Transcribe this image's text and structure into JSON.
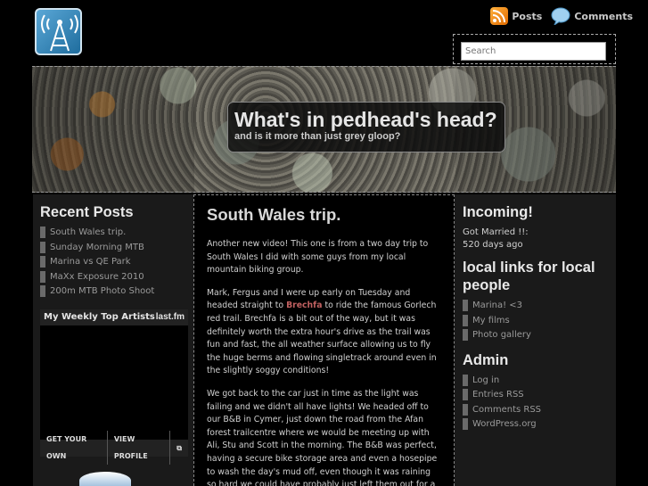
{
  "header": {
    "posts_label": "Posts",
    "comments_label": "Comments",
    "search_placeholder": "Search"
  },
  "banner": {
    "title": "What's in pedhead's head?",
    "subtitle": "and is it more than just grey gloop?"
  },
  "left": {
    "recent_title": "Recent Posts",
    "recent_posts": [
      "South Wales trip.",
      "Sunday Morning MTB",
      "Marina vs QE Park",
      "MaXx Exposure 2010",
      "200m MTB Photo Shoot"
    ],
    "lastfm_title": "My Weekly Top Artists",
    "lastfm_logo": "last.fm",
    "lastfm_get": "GET YOUR OWN",
    "lastfm_view": "VIEW PROFILE"
  },
  "post": {
    "title": "South Wales trip.",
    "p1": "Another new video! This one is from a two day trip to South Wales I did with some guys from my local mountain biking group.",
    "p2_a": "Mark, Fergus and I were up early on Tuesday and headed straight to ",
    "p2_link": "Brechfa",
    "p2_b": " to ride the famous Gorlech red trail. Brechfa is a bit out of the way, but it was definitely worth the extra hour's drive as the trail was fun and fast, the all weather surface allowing us to fly the huge berms and flowing singletrack around even in the slightly soggy conditions!",
    "p3": "We got back to the car just in time as the light was failing and we didn't all have lights! We headed off to our B&B in Cymer, just down the road from the Afan forest trailcentre where we would be meeting up with Ali, Stu and Scott in the morning. The B&B was perfect, having a secure bike storage area and even a hosepipe to wash the day's mud off, even though it was raining so hard we could have probably just left them out for a natural rinse off. We were"
  },
  "right": {
    "incoming_title": "Incoming!",
    "incoming_line1": "Got Married !!:",
    "incoming_line2": "520 days ago",
    "links_title": "local links for local people",
    "links": [
      "Marina! <3",
      "My films",
      "Photo gallery"
    ],
    "admin_title": "Admin",
    "admin_links": [
      "Log in",
      "Entries RSS",
      "Comments RSS",
      "WordPress.org"
    ]
  },
  "colors": {
    "accent_link": "#c06060",
    "sidebar_bg": "#1a1a1a"
  }
}
